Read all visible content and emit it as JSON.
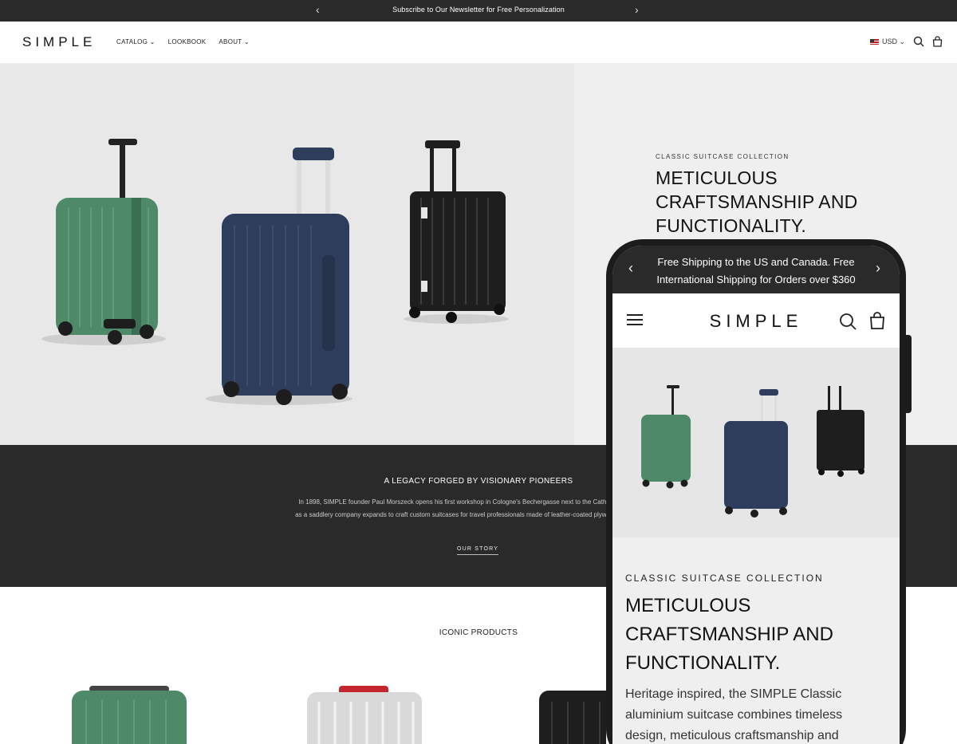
{
  "announcement": {
    "text": "Subscribe to Our Newsletter for Free Personalization",
    "prev": "‹",
    "next": "›"
  },
  "header": {
    "logo": "SIMPLE",
    "nav": [
      "CATALOG ⌄",
      "LOOKBOOK",
      "ABOUT ⌄"
    ],
    "currency": "USD ⌄"
  },
  "hero": {
    "eyebrow": "CLASSIC SUITCASE COLLECTION",
    "title_line1": "METICULOUS",
    "title_line2": "CRAFTSMANSHIP AND",
    "title_line3": "FUNCTIONALITY."
  },
  "story": {
    "heading": "A LEGACY FORGED BY VISIONARY PIONEERS",
    "body": "In 1898, SIMPLE founder Paul Morszeck opens his first workshop in Cologne's Bechergasse next to the Cathedral. What began as a saddlery company expands to craft custom suitcases for travel professionals made of leather-coated plywood and cardboard.",
    "cta": "OUR STORY"
  },
  "iconic": {
    "heading": "ICONIC PRODUCTS"
  },
  "mobile": {
    "announcement": "Free Shipping to the US and Canada. Free International Shipping for Orders over $360",
    "logo": "SIMPLE",
    "eyebrow": "CLASSIC SUITCASE COLLECTION",
    "title_line1": "METICULOUS",
    "title_line2": "CRAFTSMANSHIP AND",
    "title_line3": "FUNCTIONALITY.",
    "description": "Heritage inspired, the SIMPLE Classic aluminium suitcase combines timeless design, meticulous craftsmanship and"
  },
  "colors": {
    "dark_band": "#2a2a2a",
    "suitcase_green": "#4e8a6a",
    "suitcase_navy": "#2f3d5c",
    "suitcase_black": "#1e1e1e",
    "suitcase_silver": "#d9d9d9",
    "handle_red": "#c3262c"
  },
  "icons": [
    "chevron-left-icon",
    "chevron-right-icon",
    "flag-us-icon",
    "search-icon",
    "bag-icon",
    "menu-icon"
  ]
}
